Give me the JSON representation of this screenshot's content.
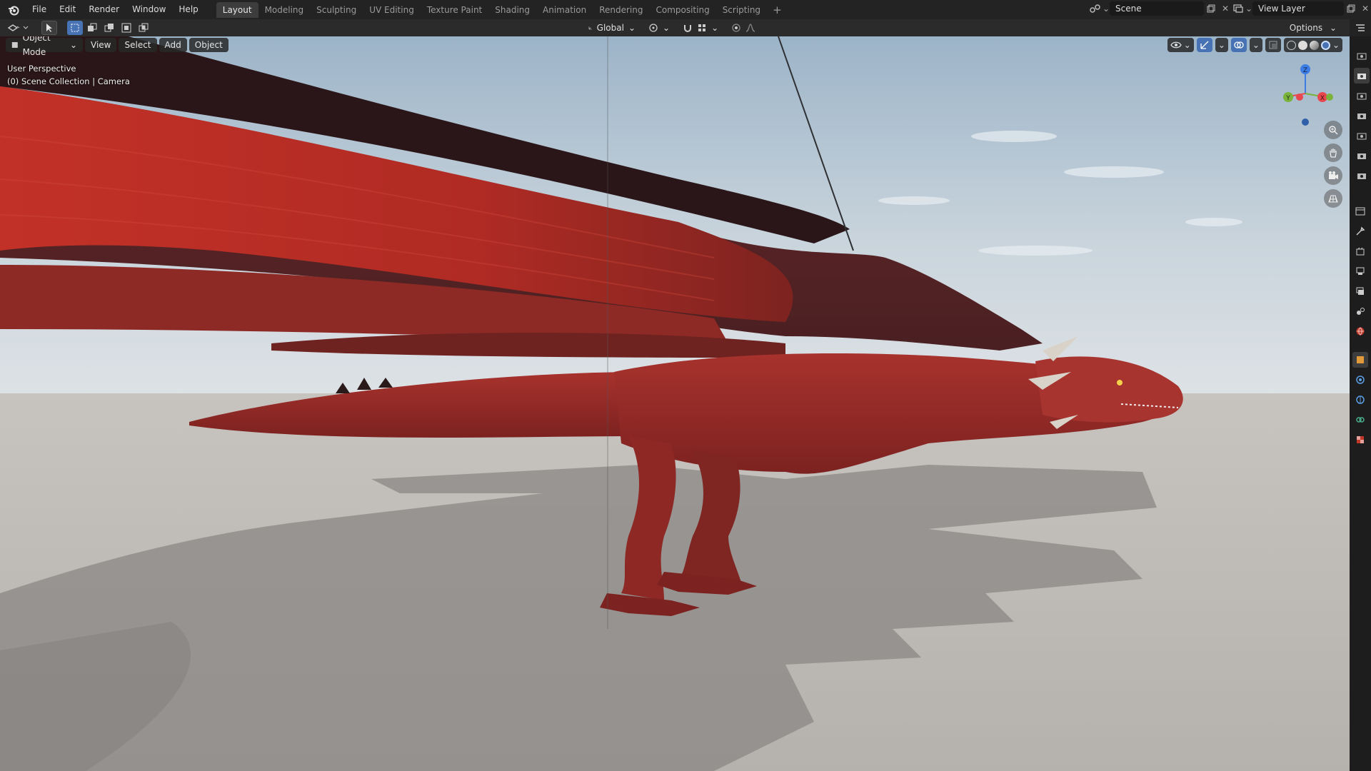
{
  "menu": [
    "File",
    "Edit",
    "Render",
    "Window",
    "Help"
  ],
  "workspaces": [
    "Layout",
    "Modeling",
    "Sculpting",
    "UV Editing",
    "Texture Paint",
    "Shading",
    "Animation",
    "Rendering",
    "Compositing",
    "Scripting"
  ],
  "active_workspace": "Layout",
  "add_workspace": "+",
  "scene": {
    "value": "Scene"
  },
  "view_layer": {
    "value": "View Layer"
  },
  "toolbar": {
    "transform_orientation": "Global",
    "options_label": "Options"
  },
  "viewport_header": {
    "mode": "Object Mode",
    "view": "View",
    "select": "Select",
    "add": "Add",
    "object": "Object"
  },
  "viewport_info": {
    "perspective": "User Perspective",
    "collection": "(0) Scene Collection | Camera"
  },
  "gizmo_axes": {
    "z": "Z",
    "y": "Y",
    "x": "X"
  },
  "colors": {
    "accent": "#4772b3",
    "dragon_red": "#a62a26",
    "x_axis": "#e8474e",
    "y_axis": "#7ab33b",
    "z_axis": "#3d7de6"
  }
}
